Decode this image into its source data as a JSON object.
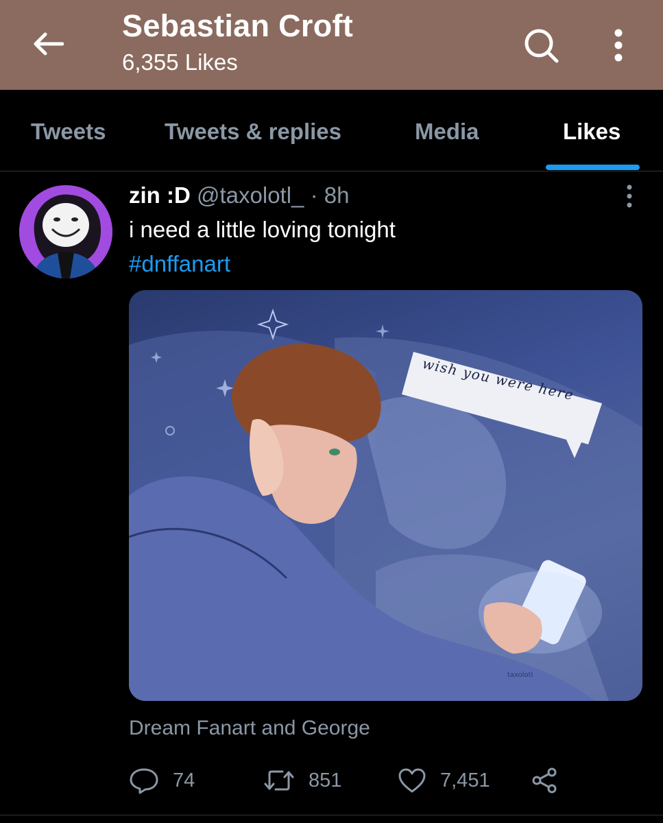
{
  "header": {
    "title": "Sebastian Croft",
    "subtitle": "6,355 Likes",
    "background": "#8b6b5f"
  },
  "tabs": [
    {
      "label": "Tweets",
      "active": false
    },
    {
      "label": "Tweets & replies",
      "active": false
    },
    {
      "label": "Media",
      "active": false
    },
    {
      "label": "Likes",
      "active": true
    }
  ],
  "tweet": {
    "name": "zin :D",
    "handle": "@taxolotl_",
    "separator": "·",
    "time": "8h",
    "text": "i need a little loving tonight",
    "hashtag": "#dnffanart",
    "media": {
      "bubble_text": "wish you were here",
      "watermark": "taxolotl"
    },
    "caption": "Dream Fanart and George",
    "stats": {
      "replies": "74",
      "retweets": "851",
      "likes": "7,451"
    }
  },
  "icons": {
    "back": "arrow-left-icon",
    "search": "search-icon",
    "more": "more-vertical-icon",
    "reply": "reply-icon",
    "retweet": "retweet-icon",
    "like": "heart-icon",
    "share": "share-icon"
  },
  "colors": {
    "accent": "#1d9bf0",
    "muted": "#8b98a5",
    "background": "#000000"
  }
}
